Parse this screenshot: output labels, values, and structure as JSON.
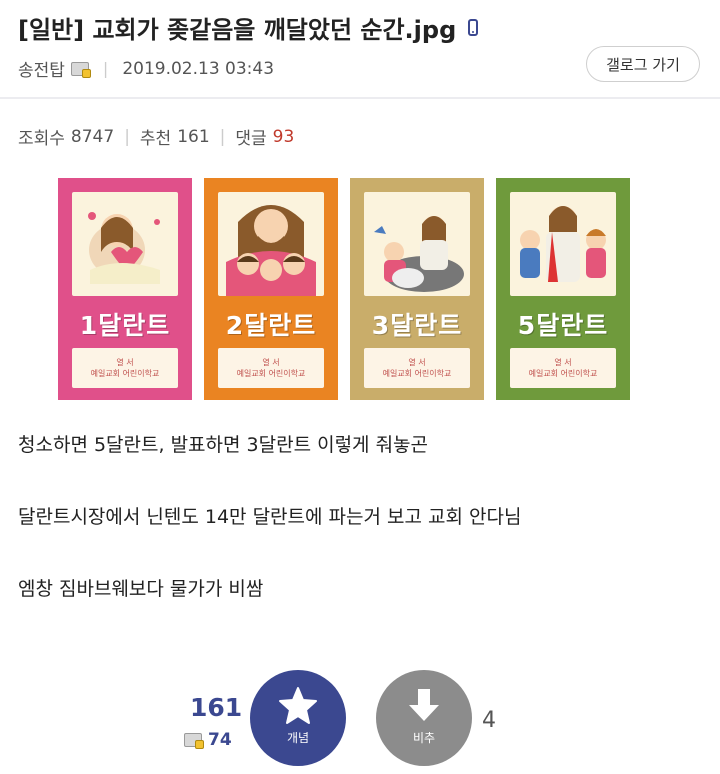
{
  "post": {
    "title": "[일반] 교회가 좆같음을 깨달았던 순간.jpg",
    "author": "송전탑",
    "date": "2019.02.13 03:43",
    "gallery_button": "갤로그 가기"
  },
  "stats": {
    "views_label": "조회수",
    "views": "8747",
    "recommend_label": "추천",
    "recommend": "161",
    "comments_label": "댓글",
    "comments": "93"
  },
  "cards": [
    {
      "label": "1달란트",
      "color": "#e0508a",
      "foot1": "열 서",
      "foot2": "예일교회 어린이학교"
    },
    {
      "label": "2달란트",
      "color": "#ea8422",
      "foot1": "열 서",
      "foot2": "예일교회 어린이학교"
    },
    {
      "label": "3달란트",
      "color": "#c9ad6a",
      "foot1": "열 서",
      "foot2": "예일교회 어린이학교"
    },
    {
      "label": "5달란트",
      "color": "#6f9a3c",
      "foot1": "열 서",
      "foot2": "예일교회 어린이학교"
    }
  ],
  "body": {
    "line1": "청소하면 5달란트, 발표하면 3달란트 이렇게 줘놓곤",
    "line2": "달란트시장에서 닌텐도 14만 달란트에 파는거 보고 교회 안다님",
    "line3": "엠창 짐바브웨보다 물가가 비쌈"
  },
  "vote": {
    "up_count": "161",
    "fixed_count": "74",
    "up_label": "개념",
    "down_label": "비추",
    "down_count": "4"
  },
  "colors": {
    "accent": "#3b4890",
    "down": "#8c8c8c",
    "comment_count": "#c0392b"
  },
  "icons": [
    "phone-icon",
    "user-icon",
    "star-icon",
    "down-arrow-icon"
  ]
}
